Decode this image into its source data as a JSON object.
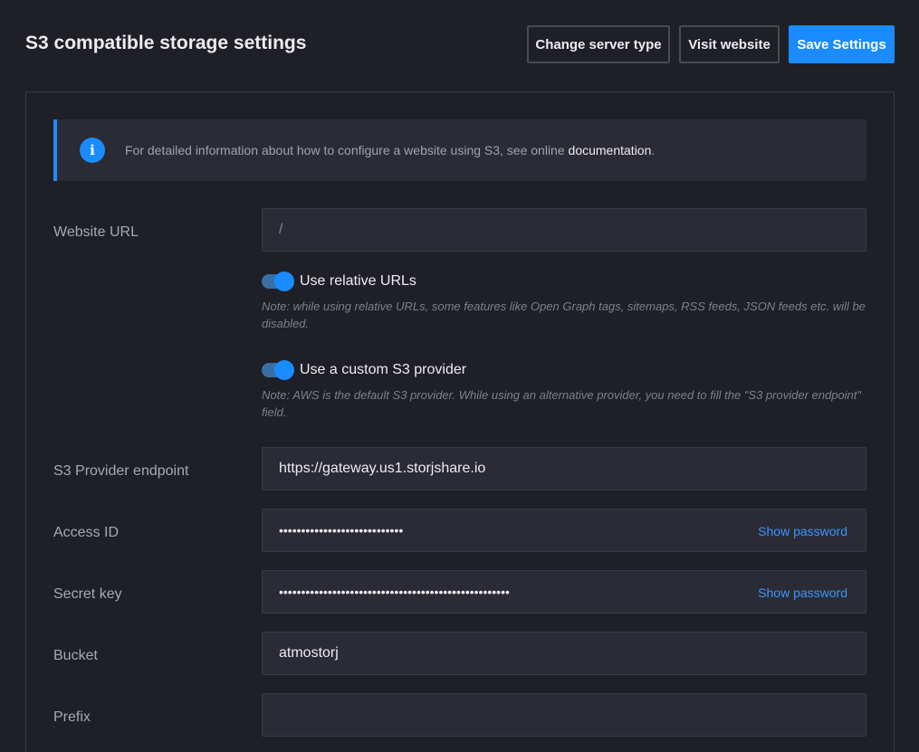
{
  "header": {
    "title": "S3 compatible storage settings",
    "change_server_label": "Change server type",
    "visit_website_label": "Visit website",
    "save_label": "Save Settings"
  },
  "info": {
    "text": "For detailed information about how to configure a website using S3, see online ",
    "link_text": "documentation",
    "suffix": ".",
    "icon": "info-icon"
  },
  "fields": {
    "website_url": {
      "label": "Website URL",
      "value": "/"
    },
    "relative_urls": {
      "label": "Use relative URLs",
      "enabled": true,
      "note": "Note: while using relative URLs, some features like Open Graph tags, sitemaps, RSS feeds, JSON feeds etc. will be disabled."
    },
    "custom_provider": {
      "label": "Use a custom S3 provider",
      "enabled": true,
      "note": "Note: AWS is the default S3 provider. While using an alternative provider, you need to fill the \"S3 provider endpoint\" field."
    },
    "endpoint": {
      "label": "S3 Provider endpoint",
      "value": "https://gateway.us1.storjshare.io"
    },
    "access_id": {
      "label": "Access ID",
      "value": "••••••••••••••••••••••••••••",
      "show_label": "Show password"
    },
    "secret_key": {
      "label": "Secret key",
      "value": "••••••••••••••••••••••••••••••••••••••••••••••••••••",
      "show_label": "Show password"
    },
    "bucket": {
      "label": "Bucket",
      "value": "atmostorj"
    },
    "prefix": {
      "label": "Prefix",
      "value": ""
    }
  },
  "colors": {
    "background": "#1f1f27",
    "accent": "#1a8cff",
    "input_bg": "#2b2b35"
  }
}
